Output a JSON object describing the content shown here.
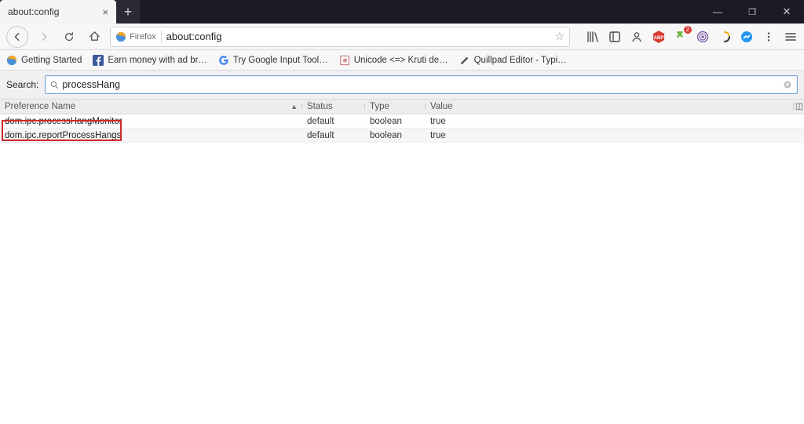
{
  "tab": {
    "title": "about:config"
  },
  "window": {
    "min": "—",
    "max": "❐",
    "close": "✕"
  },
  "nav": {
    "identity_label": "Firefox",
    "url": "about:config"
  },
  "bookmarks": [
    {
      "label": "Getting Started"
    },
    {
      "label": "Earn money with ad br…"
    },
    {
      "label": "Try Google Input Tool…"
    },
    {
      "label": "Unicode <=> Kruti de…"
    },
    {
      "label": "Quillpad Editor - Typi…"
    }
  ],
  "config": {
    "search_label": "Search:",
    "query": "processHang",
    "columns": {
      "name": "Preference Name",
      "status": "Status",
      "type": "Type",
      "value": "Value"
    },
    "rows": [
      {
        "name": "dom.ipc.processHangMonitor",
        "status": "default",
        "type": "boolean",
        "value": "true"
      },
      {
        "name": "dom.ipc.reportProcessHangs",
        "status": "default",
        "type": "boolean",
        "value": "true"
      }
    ]
  },
  "toolbar_badges": {
    "puzzle": "2"
  }
}
